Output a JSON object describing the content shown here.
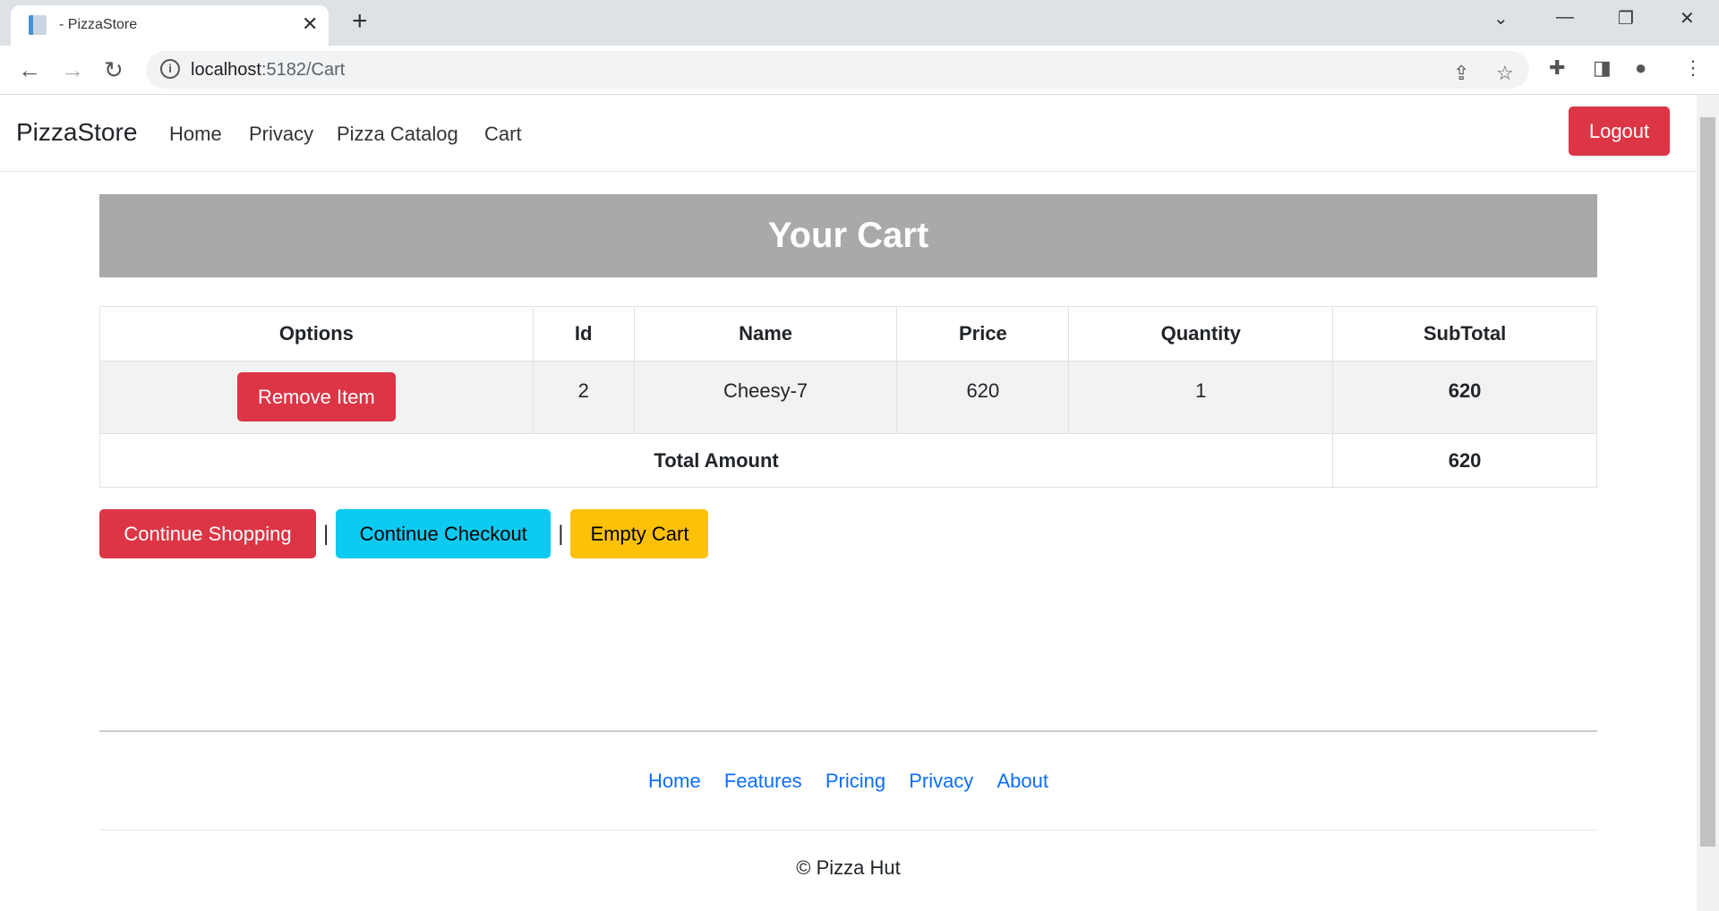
{
  "browser": {
    "tab_title": "- PizzaStore",
    "url_host": "localhost",
    "url_rest": ":5182/Cart"
  },
  "nav": {
    "brand": "PizzaStore",
    "links": [
      "Home",
      "Privacy",
      "Pizza Catalog",
      "Cart"
    ],
    "logout": "Logout"
  },
  "hero": "Your Cart",
  "table": {
    "headers": [
      "Options",
      "Id",
      "Name",
      "Price",
      "Quantity",
      "SubTotal"
    ],
    "rows": [
      {
        "action": "Remove Item",
        "id": "2",
        "name": "Cheesy-7",
        "price": "620",
        "quantity": "1",
        "subtotal": "620"
      }
    ],
    "total_label": "Total Amount",
    "total_value": "620"
  },
  "actions": {
    "continue_shopping": "Continue Shopping",
    "sep": "|",
    "continue_checkout": "Continue Checkout",
    "empty_cart": "Empty Cart"
  },
  "footer": {
    "links": [
      "Home",
      "Features",
      "Pricing",
      "Privacy",
      "About"
    ],
    "copyright": "© Pizza Hut"
  }
}
